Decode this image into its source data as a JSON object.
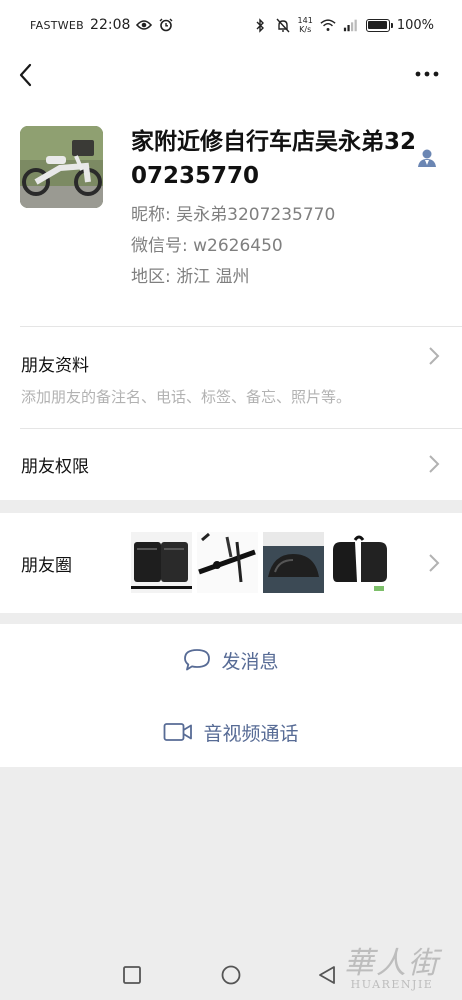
{
  "status_bar": {
    "carrier": "FASTWEB",
    "time": "22:08",
    "net_speed_value": "141",
    "net_speed_unit": "K/s",
    "battery": "100%"
  },
  "profile": {
    "name": "家附近修自行车店吴永弟3207235770",
    "nickname": "昵称:  吴永弟3207235770",
    "wechat_id": "微信号:  w2626450",
    "region": "地区:  浙江  温州"
  },
  "rows": {
    "friend_info_title": "朋友资料",
    "friend_info_sub": "添加朋友的备注名、电话、标签、备忘、照片等。",
    "friend_permissions_title": "朋友权限",
    "moments_title": "朋友圈"
  },
  "actions": {
    "message": "发消息",
    "call": "音视频通话"
  },
  "watermark": {
    "cn": "華人街",
    "en": "HUARENJIE"
  },
  "colors": {
    "link_blue": "#576b95",
    "background": "#ededed"
  },
  "icons": [
    "back-icon",
    "more-icon",
    "contact-icon",
    "chevron-right-icon",
    "chat-bubble-icon",
    "video-camera-icon"
  ]
}
